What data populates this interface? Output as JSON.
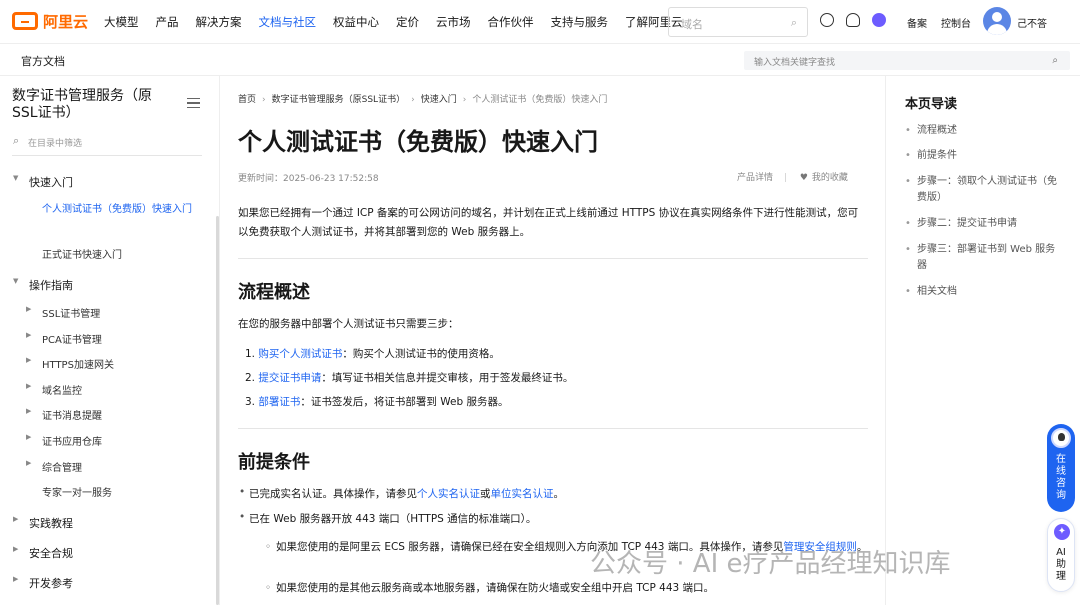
{
  "header": {
    "logo_text": "阿里云",
    "nav": [
      "大模型",
      "产品",
      "解决方案",
      "文档与社区",
      "权益中心",
      "定价",
      "云市场",
      "合作伙伴",
      "支持与服务",
      "了解阿里云"
    ],
    "search_placeholder": "域名",
    "links": [
      "备案",
      "控制台"
    ],
    "username": "己不答"
  },
  "subbar": {
    "title": "官方文档",
    "search_placeholder": "输入文档关键字查找"
  },
  "sidebar": {
    "title": "数字证书管理服务（原SSL证书）",
    "filter_placeholder": "在目录中筛选",
    "quick_start": "快速入门",
    "quick_items": [
      "个人测试证书（免费版）快速入门",
      "正式证书快速入门"
    ],
    "ops_guide": "操作指南",
    "ops_items": [
      "SSL证书管理",
      "PCA证书管理",
      "HTTPS加速网关",
      "域名监控",
      "证书消息提醒",
      "证书应用仓库",
      "综合管理"
    ],
    "expert": "专家一对一服务",
    "practice": "实践教程",
    "security": "安全合规",
    "dev": "开发参考"
  },
  "main": {
    "breadcrumb": [
      "首页",
      "数字证书管理服务（原SSL证书）",
      "快速入门",
      "个人测试证书（免费版）快速入门"
    ],
    "title": "个人测试证书（免费版）快速入门",
    "updated": "更新时间：2025-06-23 17:52:58",
    "product_detail": "产品详情",
    "favorite": "我的收藏",
    "intro": "如果您已经拥有一个通过 ICP 备案的可公网访问的域名，并计划在正式上线前通过 HTTPS 协议在真实网络条件下进行性能测试，您可以免费获取个人测试证书，并将其部署到您的 Web 服务器上。",
    "flow_title": "流程概述",
    "flow_desc": "在您的服务器中部署个人测试证书只需要三步：",
    "steps": [
      {
        "num": "1.",
        "link": "购买个人测试证书",
        "text": "：购买个人测试证书的使用资格。"
      },
      {
        "num": "2.",
        "link": "提交证书申请",
        "text": "：填写证书相关信息并提交审核，用于签发最终证书。"
      },
      {
        "num": "3.",
        "link": "部署证书",
        "text": "：证书签发后，将证书部署到 Web 服务器。"
      }
    ],
    "prereq_title": "前提条件",
    "prereq1_a": "已完成实名认证。具体操作，请参见",
    "prereq1_link1": "个人实名认证",
    "prereq1_or": "或",
    "prereq1_link2": "单位实名认证",
    "prereq1_end": "。",
    "prereq2": "已在 Web 服务器开放 443 端口（HTTPS 通信的标准端口）。",
    "sub1_a": "如果您使用的是阿里云 ECS 服务器，请确保已经在安全组规则入方向添加 TCP 443 端口。具体操作，请参见",
    "sub1_link": "管理安全组规则",
    "sub1_end": "。",
    "sub2": "如果您使用的是其他云服务商或本地服务器，请确保在防火墙或安全组中开启 TCP 443 端口。"
  },
  "toc": {
    "title": "本页导读",
    "items": [
      "流程概述",
      "前提条件",
      "步骤一：领取个人测试证书（免费版）",
      "步骤二：提交证书申请",
      "步骤三：部署证书到 Web 服务器",
      "相关文档"
    ]
  },
  "floating": {
    "chat": "在线咨询",
    "ai": "AI助理"
  },
  "watermark": "公众号 · AI e疗产品经理知识库",
  "colors": {
    "accent": "#1e64f0",
    "brand": "#ff6a00"
  }
}
